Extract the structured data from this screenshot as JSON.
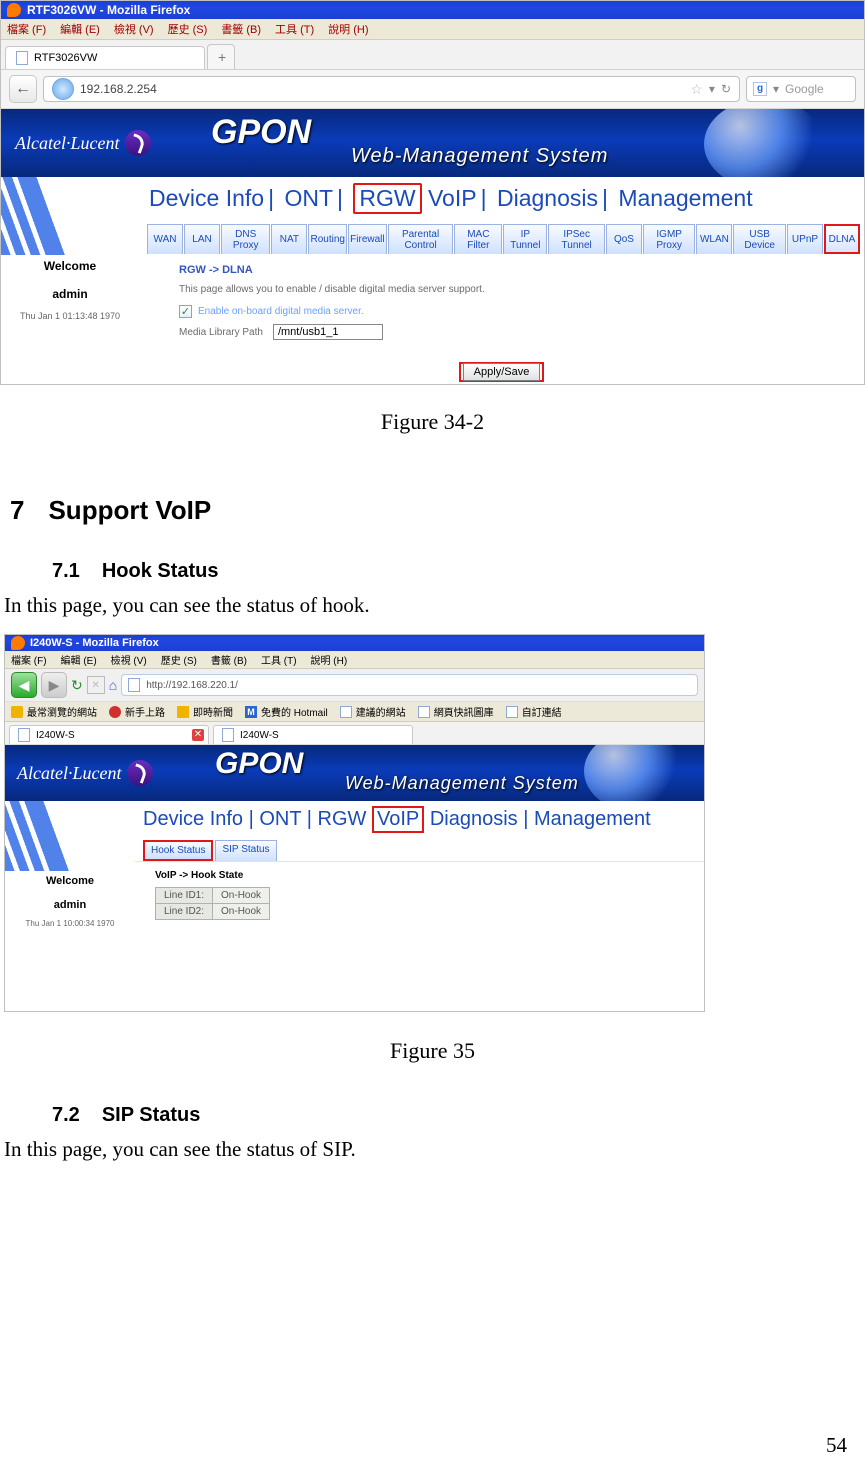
{
  "fig34": {
    "window_title": "RTF3026VW - Mozilla Firefox",
    "menubar": [
      "檔案 (F)",
      "編輯 (E)",
      "檢視 (V)",
      "歷史 (S)",
      "書籤 (B)",
      "工具 (T)",
      "說明 (H)"
    ],
    "tab_label": "RTF3026VW",
    "tab_new": "+",
    "url": "192.168.2.254",
    "search_placeholder": "Google",
    "search_icon_letter": "g",
    "brand": "Alcatel·Lucent",
    "gpon": "GPON",
    "wms": "Web-Management System",
    "welcome": "Welcome",
    "user": "admin",
    "timestamp": "Thu Jan 1 01:13:48 1970",
    "topnav": [
      "Device Info",
      "ONT",
      "RGW",
      "VoIP",
      "Diagnosis",
      "Management"
    ],
    "topnav_selected": "RGW",
    "subtabs": [
      "WAN",
      "LAN",
      "DNS Proxy",
      "NAT",
      "Routing",
      "Firewall",
      "Parental Control",
      "MAC Filter",
      "IP Tunnel",
      "IPSec Tunnel",
      "QoS",
      "IGMP Proxy",
      "WLAN",
      "USB Device",
      "UPnP",
      "DLNA"
    ],
    "subtab_selected": "DLNA",
    "breadcrumb": "RGW -> DLNA",
    "desc": "This page allows you to enable / disable digital media server support.",
    "checkbox_label": "Enable on-board digital media server.",
    "media_label": "Media Library Path",
    "media_value": "/mnt/usb1_1",
    "apply_label": "Apply/Save"
  },
  "doc": {
    "caption34": "Figure 34-2",
    "h7_num": "7",
    "h7": "Support VoIP",
    "h71_num": "7.1",
    "h71": "Hook Status",
    "p71": "In this page, you can see the status of hook.",
    "caption35": "Figure 35",
    "h72_num": "7.2",
    "h72": "SIP Status",
    "p72": "In this page, you can see the status of SIP.",
    "pagenum": "54"
  },
  "fig35": {
    "window_title": "I240W-S - Mozilla Firefox",
    "menubar": [
      "檔案 (F)",
      "編輯 (E)",
      "檢視 (V)",
      "歷史 (S)",
      "書籤 (B)",
      "工具 (T)",
      "說明 (H)"
    ],
    "url": "http://192.168.220.1/",
    "bookmarks": [
      "最常瀏覽的網站",
      "新手上路",
      "即時新聞",
      "免費的 Hotmail",
      "建議的網站",
      "網頁快訊圖庫",
      "自訂連結"
    ],
    "tab1": "I240W-S",
    "tab2": "I240W-S",
    "brand": "Alcatel·Lucent",
    "gpon": "GPON",
    "wms": "Web-Management System",
    "welcome": "Welcome",
    "user": "admin",
    "timestamp": "Thu Jan 1 10:00:34 1970",
    "topnav": [
      "Device Info",
      "ONT",
      "RGW",
      "VoIP",
      "Diagnosis",
      "Management"
    ],
    "topnav_selected": "VoIP",
    "subtabs": [
      "Hook Status",
      "SIP Status"
    ],
    "subtab_selected": "Hook Status",
    "breadcrumb": "VoIP -> Hook State",
    "rows": [
      {
        "label": "Line ID1:",
        "value": "On-Hook"
      },
      {
        "label": "Line ID2:",
        "value": "On-Hook"
      }
    ]
  }
}
